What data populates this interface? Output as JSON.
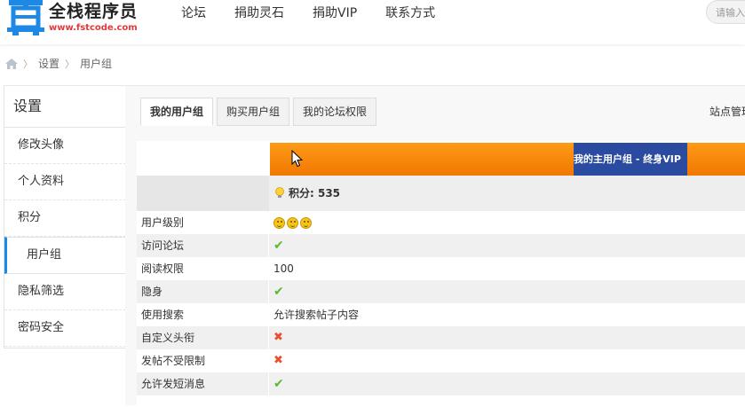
{
  "brand": {
    "title": "全栈程序员",
    "url": "www.fstcode.com",
    "logo_icon": "zhen-character-logo",
    "accent": "#1e88e5"
  },
  "nav": [
    "论坛",
    "捐助灵石",
    "捐助VIP",
    "联系方式"
  ],
  "search": {
    "placeholder": "请输入"
  },
  "breadcrumb": {
    "home_icon": "home-icon",
    "items": [
      "设置",
      "用户组"
    ]
  },
  "sidebar": {
    "title": "设置",
    "items": [
      "修改头像",
      "个人资料",
      "积分",
      "用户组",
      "隐私筛选",
      "密码安全"
    ],
    "active": "用户组"
  },
  "tabs": [
    "我的用户组",
    "购买用户组",
    "我的论坛权限"
  ],
  "admin_link": "站点管理",
  "group": {
    "header": "我的主用户组 - 终身VIP",
    "score_label": "积分: 535",
    "header_color": "#f07800",
    "vip_color": "#2b4ba1"
  },
  "permissions": [
    {
      "label": "用户级别",
      "type": "faces",
      "count": 3
    },
    {
      "label": "访问论坛",
      "type": "yes"
    },
    {
      "label": "阅读权限",
      "type": "text",
      "value": "100"
    },
    {
      "label": "隐身",
      "type": "yes"
    },
    {
      "label": "使用搜索",
      "type": "text",
      "value": "允许搜索帖子内容"
    },
    {
      "label": "自定义头衔",
      "type": "no"
    },
    {
      "label": "发帖不受限制",
      "type": "no"
    },
    {
      "label": "允许发短消息",
      "type": "yes"
    }
  ]
}
